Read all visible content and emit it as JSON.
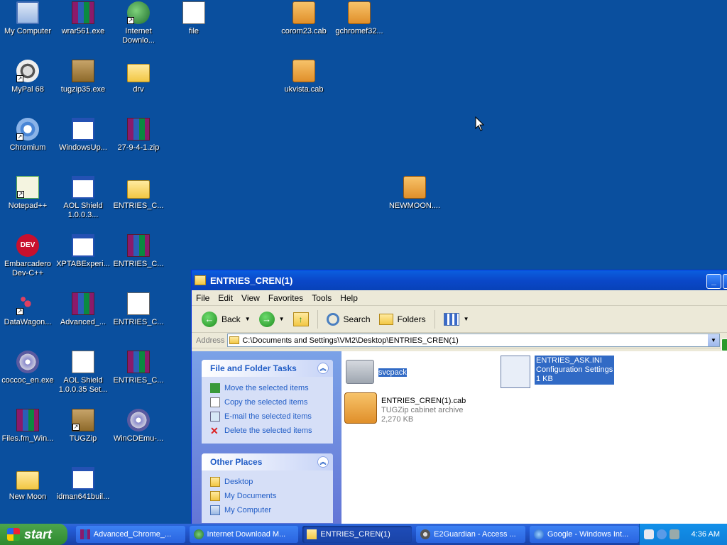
{
  "desktop": {
    "icons": [
      {
        "label": "My Computer",
        "icon": "my-computer-icon"
      },
      {
        "label": "wrar561.exe",
        "icon": "winrar-icon"
      },
      {
        "label": "Internet Downlo...",
        "icon": "internet-download-icon"
      },
      {
        "label": "file",
        "icon": "text-file-icon"
      },
      {
        "label": "corom23.cab",
        "icon": "cab-icon"
      },
      {
        "label": "gchromef32...",
        "icon": "cab-icon"
      },
      {
        "label": "MyPal 68",
        "icon": "mypal-icon"
      },
      {
        "label": "tugzip35.exe",
        "icon": "tugzip-setup-icon"
      },
      {
        "label": "drv",
        "icon": "folder-icon"
      },
      {
        "label": "ukvista.cab",
        "icon": "cab-icon"
      },
      {
        "label": "Chromium",
        "icon": "chromium-icon"
      },
      {
        "label": "WindowsUp...",
        "icon": "window-app-icon"
      },
      {
        "label": "27-9-4-1.zip",
        "icon": "winrar-icon"
      },
      {
        "label": "Notepad++",
        "icon": "notepad-plus-icon"
      },
      {
        "label": "AOL Shield 1.0.0.3...",
        "icon": "window-app-icon"
      },
      {
        "label": "ENTRIES_C...",
        "icon": "folder-icon"
      },
      {
        "label": "NEWMOON....",
        "icon": "cab-icon"
      },
      {
        "label": "Embarcadero Dev-C++",
        "icon": "dev-cpp-icon"
      },
      {
        "label": "XPTABExperi...",
        "icon": "xptab-icon"
      },
      {
        "label": "ENTRIES_C...",
        "icon": "winrar-icon"
      },
      {
        "label": "DataWagon...",
        "icon": "datawagon-icon"
      },
      {
        "label": "Advanced_...",
        "icon": "winrar-icon"
      },
      {
        "label": "ENTRIES_C...",
        "icon": "ini-file-icon"
      },
      {
        "label": "coccoc_en.exe",
        "icon": "setup-icon"
      },
      {
        "label": "AOL Shield 1.0.0.35 Set...",
        "icon": "ini-file-icon"
      },
      {
        "label": "ENTRIES_C...",
        "icon": "winrar-icon"
      },
      {
        "label": "Files.fm_Win...",
        "icon": "winrar-icon"
      },
      {
        "label": "TUGZip",
        "icon": "tugzip-icon"
      },
      {
        "label": "WinCDEmu-...",
        "icon": "cd-icon"
      },
      {
        "label": "New Moon",
        "icon": "folder-icon"
      },
      {
        "label": "idman641buil...",
        "icon": "idm-setup-icon"
      }
    ]
  },
  "window": {
    "title": "ENTRIES_CREN(1)",
    "menu": [
      "File",
      "Edit",
      "View",
      "Favorites",
      "Tools",
      "Help"
    ],
    "toolbar": {
      "back": "Back",
      "search": "Search",
      "folders": "Folders"
    },
    "address": {
      "label": "Address",
      "value": "C:\\Documents and Settings\\VM2\\Desktop\\ENTRIES_CREN(1)"
    },
    "tasks_panel": {
      "title": "File and Folder Tasks",
      "items": [
        "Move the selected items",
        "Copy the selected items",
        "E-mail the selected items",
        "Delete the selected items"
      ]
    },
    "places_panel": {
      "title": "Other Places",
      "items": [
        "Desktop",
        "My Documents",
        "My Computer"
      ]
    },
    "files": [
      {
        "name": "svcpack",
        "type": "",
        "size": "",
        "selected": true
      },
      {
        "name": "ENTRIES_ASK.INI",
        "type": "Configuration Settings",
        "size": "1 KB",
        "selected": true
      },
      {
        "name": "ENTRIES_CREN(1).cab",
        "type": "TUGZip cabinet archive",
        "size": "2,270 KB",
        "selected": false
      }
    ]
  },
  "taskbar": {
    "start": "start",
    "tasks": [
      {
        "label": "Advanced_Chrome_...",
        "active": false
      },
      {
        "label": "Internet Download M...",
        "active": false
      },
      {
        "label": "ENTRIES_CREN(1)",
        "active": true
      },
      {
        "label": "E2Guardian - Access ...",
        "active": false
      },
      {
        "label": "Google - Windows Int...",
        "active": false
      }
    ],
    "clock": "4:36 AM"
  }
}
